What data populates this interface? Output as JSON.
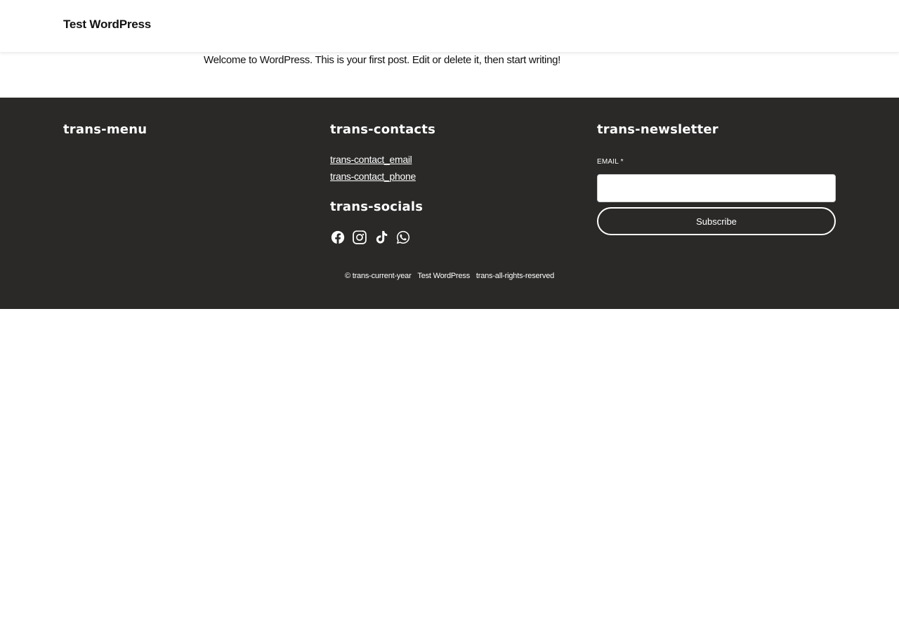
{
  "header": {
    "site_title": "Test WordPress"
  },
  "post": {
    "content": "Welcome to WordPress. This is your first post. Edit or delete it, then start writing!"
  },
  "footer": {
    "menu_title": "trans-menu",
    "contacts_title": "trans-contacts",
    "contact_email": "trans-contact_email",
    "contact_phone": "trans-contact_phone",
    "socials_title": "trans-socials",
    "socials": [
      "facebook-icon",
      "instagram-icon",
      "tiktok-icon",
      "whatsapp-icon"
    ],
    "newsletter_title": "trans-newsletter",
    "email_label": "EMAIL *",
    "email_value": "",
    "subscribe_label": "Subscribe",
    "copyright_symbol_year": "© trans-current-year",
    "copyright_site": "Test WordPress",
    "copyright_rights": "trans-all-rights-reserved"
  },
  "colors": {
    "footer_background": "#2a2928",
    "footer_text": "#ffffff",
    "page_background": "#ffffff"
  }
}
